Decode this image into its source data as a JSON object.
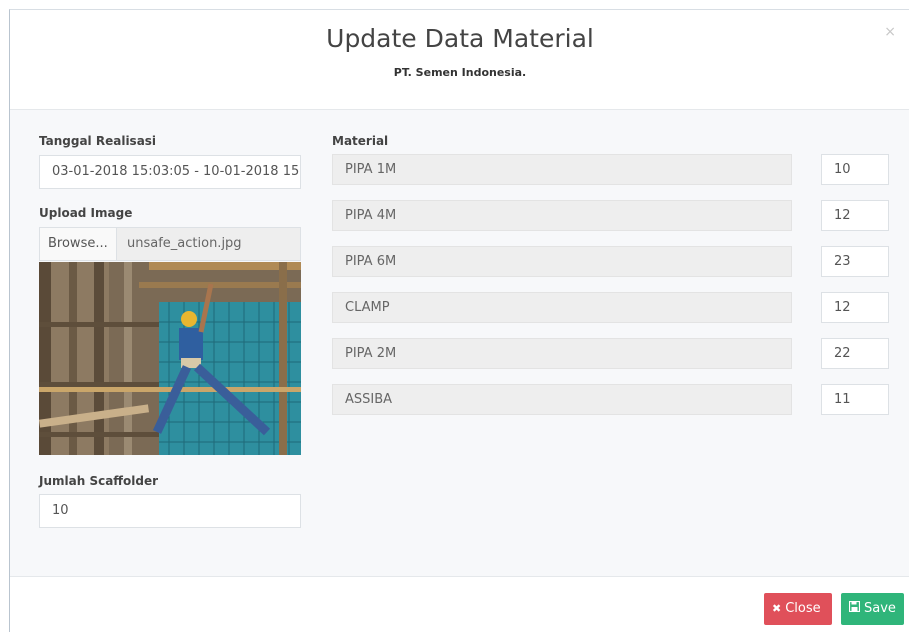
{
  "header": {
    "title": "Update Data Material",
    "subtitle": "PT. Semen Indonesia.",
    "close_icon": "×"
  },
  "form": {
    "tanggal_label": "Tanggal Realisasi",
    "tanggal_value": "03-01-2018 15:03:05 - 10-01-2018 15",
    "upload_label": "Upload Image",
    "browse_label": "Browse...",
    "file_name": "unsafe_action.jpg",
    "jumlah_label": "Jumlah Scaffolder",
    "jumlah_value": "10",
    "material_label": "Material",
    "materials": [
      {
        "name": "PIPA 1M",
        "qty": "10"
      },
      {
        "name": "PIPA 4M",
        "qty": "12"
      },
      {
        "name": "PIPA 6M",
        "qty": "23"
      },
      {
        "name": "CLAMP",
        "qty": "12"
      },
      {
        "name": "PIPA 2M",
        "qty": "22"
      },
      {
        "name": "ASSIBA",
        "qty": "11"
      }
    ]
  },
  "footer": {
    "close_label": "Close",
    "close_icon": "✖",
    "save_label": "Save",
    "save_icon": "💾"
  },
  "colors": {
    "close_button": "#e0505a",
    "save_button": "#2fb57a"
  }
}
